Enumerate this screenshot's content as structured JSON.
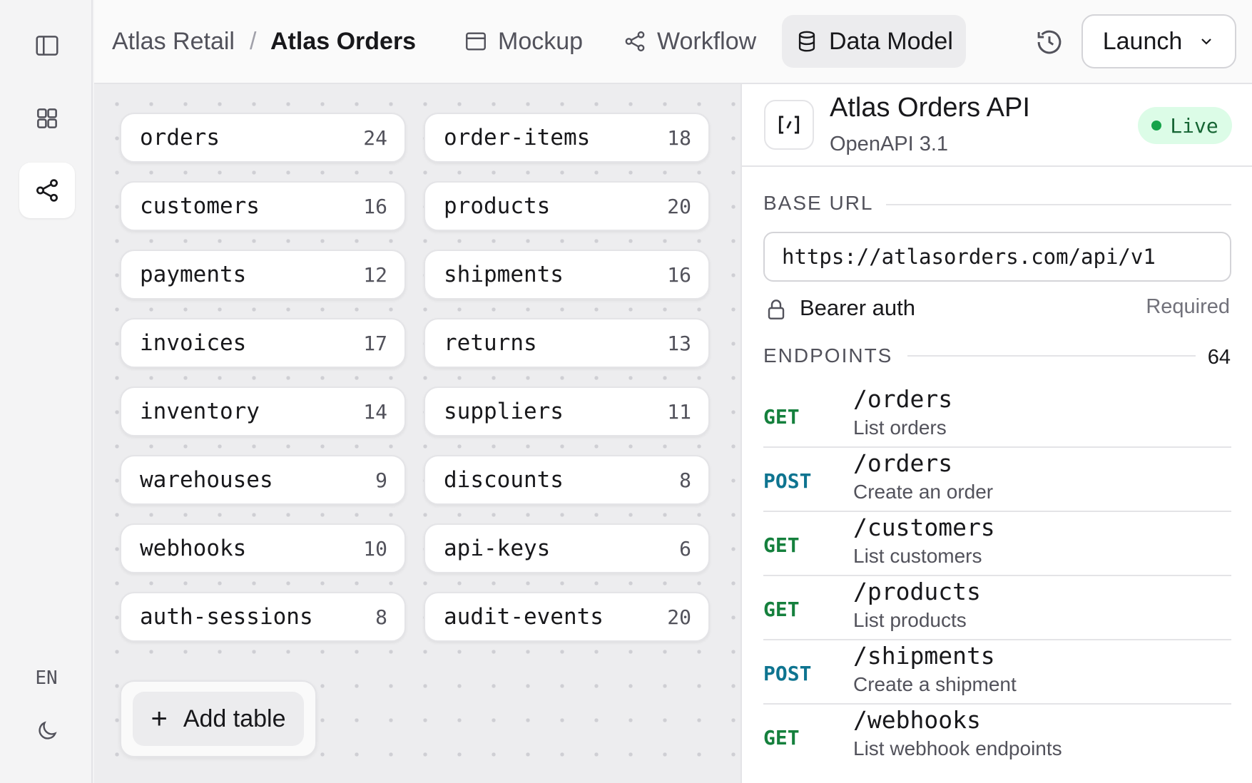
{
  "rail": {
    "lang": "EN"
  },
  "breadcrumb": {
    "parent": "Atlas Retail",
    "separator": "/",
    "current": "Atlas Orders"
  },
  "tabs": [
    {
      "label": "Mockup",
      "icon": "window-icon"
    },
    {
      "label": "Workflow",
      "icon": "share-icon"
    },
    {
      "label": "Data Model",
      "icon": "database-icon",
      "active": true
    }
  ],
  "launch": {
    "label": "Launch"
  },
  "tables": [
    {
      "name": "orders",
      "count": "24"
    },
    {
      "name": "order-items",
      "count": "18"
    },
    {
      "name": "customers",
      "count": "16"
    },
    {
      "name": "products",
      "count": "20"
    },
    {
      "name": "payments",
      "count": "12"
    },
    {
      "name": "shipments",
      "count": "16"
    },
    {
      "name": "invoices",
      "count": "17"
    },
    {
      "name": "returns",
      "count": "13"
    },
    {
      "name": "inventory",
      "count": "14"
    },
    {
      "name": "suppliers",
      "count": "11"
    },
    {
      "name": "warehouses",
      "count": "9"
    },
    {
      "name": "discounts",
      "count": "8"
    },
    {
      "name": "webhooks",
      "count": "10"
    },
    {
      "name": "api-keys",
      "count": "6"
    },
    {
      "name": "auth-sessions",
      "count": "8"
    },
    {
      "name": "audit-events",
      "count": "20"
    }
  ],
  "add_table": {
    "plus": "+",
    "label": "Add table"
  },
  "api": {
    "title": "Atlas Orders API",
    "subtitle": "OpenAPI 3.1",
    "status": "Live",
    "status_color": "#16a34a",
    "base_url_label": "BASE URL",
    "base_url": "https://atlasorders.com/api/v1",
    "auth_label": "Bearer auth",
    "auth_required": "Required",
    "endpoints_label": "ENDPOINTS",
    "endpoints_count": "64",
    "endpoints": [
      {
        "method": "GET",
        "path": "/orders",
        "desc": "List orders"
      },
      {
        "method": "POST",
        "path": "/orders",
        "desc": "Create an order"
      },
      {
        "method": "GET",
        "path": "/customers",
        "desc": "List customers"
      },
      {
        "method": "GET",
        "path": "/products",
        "desc": "List products"
      },
      {
        "method": "POST",
        "path": "/shipments",
        "desc": "Create a shipment"
      },
      {
        "method": "GET",
        "path": "/webhooks",
        "desc": "List webhook endpoints"
      }
    ]
  }
}
